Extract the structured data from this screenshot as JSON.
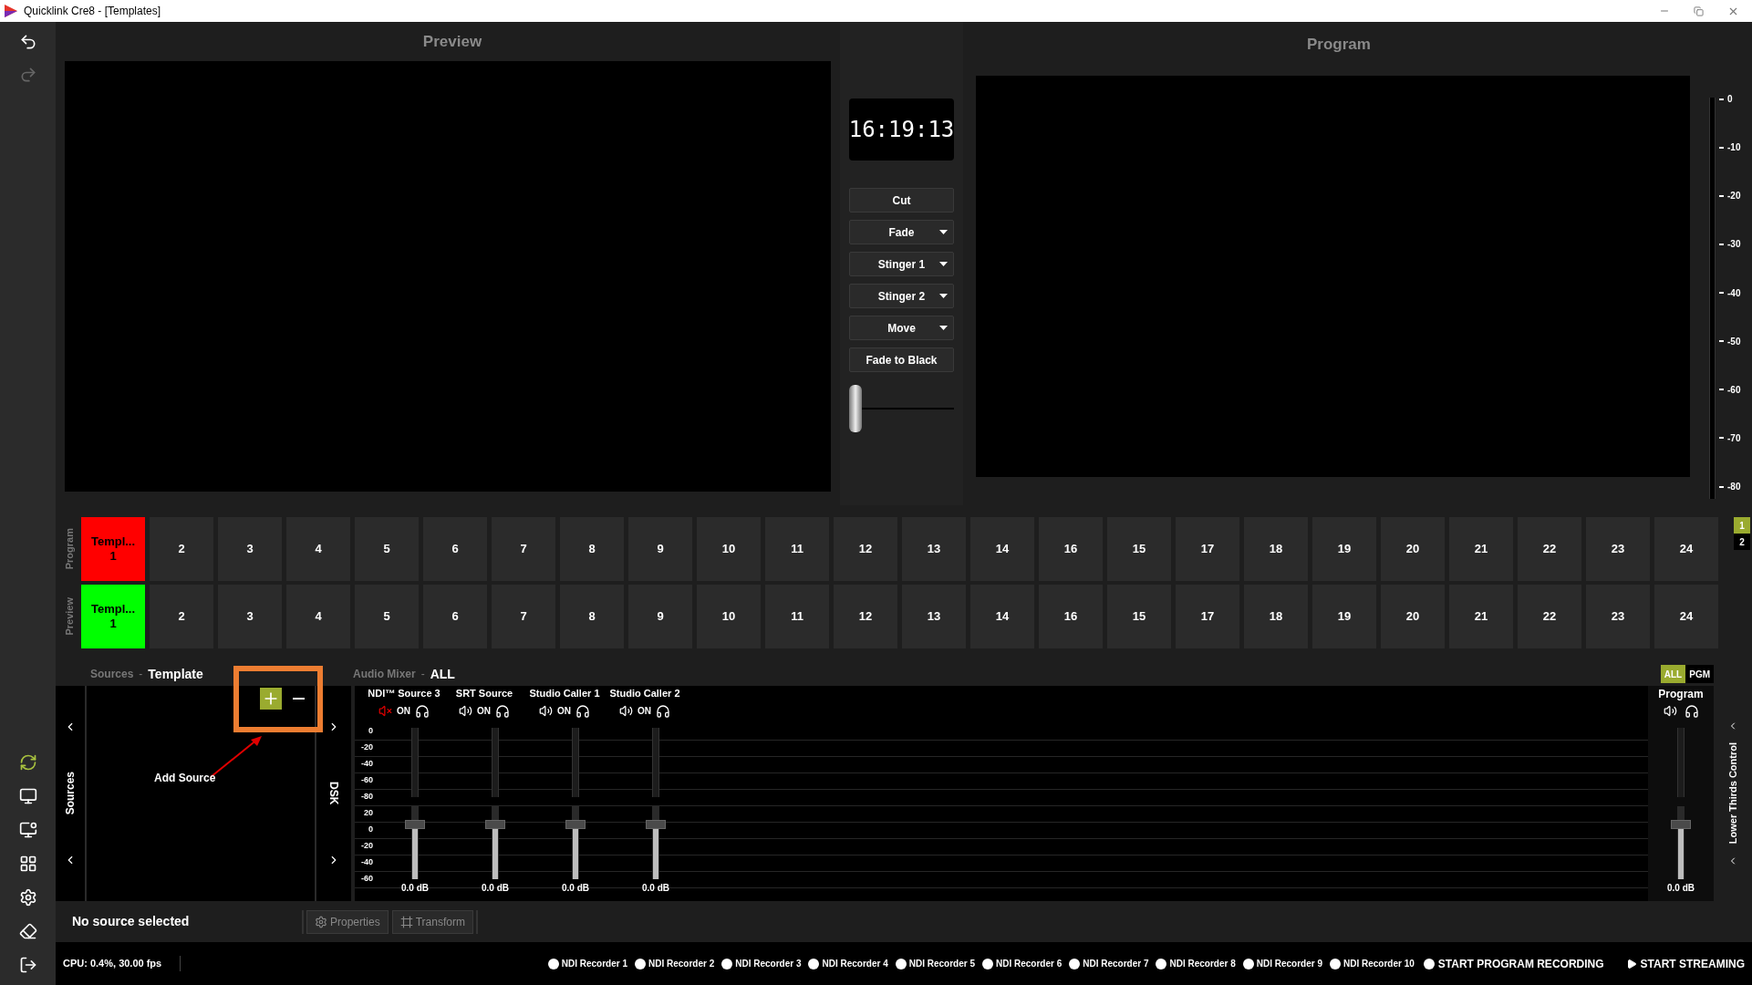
{
  "window": {
    "title": "Quicklink Cre8 - [Templates]"
  },
  "preview": {
    "label": "Preview"
  },
  "program": {
    "label": "Program"
  },
  "clock": "16:19:13",
  "transitions": [
    {
      "label": "Cut",
      "dropdown": false
    },
    {
      "label": "Fade",
      "dropdown": true
    },
    {
      "label": "Stinger 1",
      "dropdown": true
    },
    {
      "label": "Stinger 2",
      "dropdown": true
    },
    {
      "label": "Move",
      "dropdown": true
    },
    {
      "label": "Fade to Black",
      "dropdown": false
    }
  ],
  "t_bar": {
    "level": 0
  },
  "vu_meter": {
    "ticks": [
      "0",
      "-10",
      "-20",
      "-30",
      "-40",
      "-50",
      "-60",
      "-70",
      "-80"
    ]
  },
  "switcher": {
    "rows": [
      {
        "label": "Program",
        "kind": "program",
        "cells": [
          {
            "label": "Templ...",
            "number": "1",
            "selected": true
          },
          {
            "label": "2",
            "selected": false
          },
          {
            "label": "3",
            "selected": false
          },
          {
            "label": "4",
            "selected": false
          },
          {
            "label": "5",
            "selected": false
          },
          {
            "label": "6",
            "selected": false
          },
          {
            "label": "7",
            "selected": false
          },
          {
            "label": "8",
            "selected": false
          },
          {
            "label": "9",
            "selected": false
          },
          {
            "label": "10",
            "selected": false
          },
          {
            "label": "11",
            "selected": false
          },
          {
            "label": "12",
            "selected": false
          },
          {
            "label": "13",
            "selected": false
          },
          {
            "label": "14",
            "selected": false
          },
          {
            "label": "16",
            "selected": false
          },
          {
            "label": "15",
            "selected": false
          },
          {
            "label": "17",
            "selected": false
          },
          {
            "label": "18",
            "selected": false
          },
          {
            "label": "19",
            "selected": false
          },
          {
            "label": "20",
            "selected": false
          },
          {
            "label": "21",
            "selected": false
          },
          {
            "label": "22",
            "selected": false
          },
          {
            "label": "23",
            "selected": false
          },
          {
            "label": "24",
            "selected": false
          }
        ]
      },
      {
        "label": "Preview",
        "kind": "preview",
        "cells": [
          {
            "label": "Templ...",
            "number": "1",
            "selected": true
          },
          {
            "label": "2",
            "selected": false
          },
          {
            "label": "3",
            "selected": false
          },
          {
            "label": "4",
            "selected": false
          },
          {
            "label": "5",
            "selected": false
          },
          {
            "label": "6",
            "selected": false
          },
          {
            "label": "7",
            "selected": false
          },
          {
            "label": "8",
            "selected": false
          },
          {
            "label": "9",
            "selected": false
          },
          {
            "label": "10",
            "selected": false
          },
          {
            "label": "11",
            "selected": false
          },
          {
            "label": "12",
            "selected": false
          },
          {
            "label": "13",
            "selected": false
          },
          {
            "label": "14",
            "selected": false
          },
          {
            "label": "16",
            "selected": false
          },
          {
            "label": "15",
            "selected": false
          },
          {
            "label": "17",
            "selected": false
          },
          {
            "label": "18",
            "selected": false
          },
          {
            "label": "19",
            "selected": false
          },
          {
            "label": "20",
            "selected": false
          },
          {
            "label": "21",
            "selected": false
          },
          {
            "label": "22",
            "selected": false
          },
          {
            "label": "23",
            "selected": false
          },
          {
            "label": "24",
            "selected": false
          }
        ]
      }
    ],
    "pages": [
      {
        "label": "1",
        "selected": true
      },
      {
        "label": "2",
        "selected": false
      }
    ]
  },
  "sources": {
    "title": "Sources",
    "separator": "-",
    "subtitle": "Template",
    "side_label": "Sources",
    "annotation": "Add Source"
  },
  "dsk": {
    "label": "DSK"
  },
  "audio_mixer": {
    "title": "Audio Mixer",
    "separator": "-",
    "filter": "ALL",
    "toggles": [
      {
        "label": "ALL",
        "selected": true
      },
      {
        "label": "PGM",
        "selected": false
      }
    ],
    "scale": [
      "0",
      "-20",
      "-40",
      "-60",
      "-80",
      "20",
      "0",
      "-20",
      "-40",
      "-60"
    ],
    "channels": [
      {
        "name": "NDI™ Source 3",
        "muted": true,
        "state": "ON",
        "level": 0.75,
        "reading": "0.0 dB"
      },
      {
        "name": "SRT Source",
        "muted": false,
        "state": "ON",
        "level": 0.75,
        "reading": "0.0 dB"
      },
      {
        "name": "Studio Caller 1",
        "muted": false,
        "state": "ON",
        "level": 0.75,
        "reading": "0.0 dB"
      },
      {
        "name": "Studio Caller 2",
        "muted": false,
        "state": "ON",
        "level": 0.75,
        "reading": "0.0 dB"
      }
    ],
    "master": {
      "name": "Program",
      "level": 0.75,
      "reading": "0.0 dB"
    }
  },
  "lower_thirds": {
    "label": "Lower Thirds Control"
  },
  "toolbar": {
    "status": "No source selected",
    "buttons": [
      {
        "label": "Properties",
        "kind": "properties",
        "disabled": true
      },
      {
        "label": "Transform",
        "kind": "transform",
        "disabled": true
      }
    ]
  },
  "status_bar": {
    "cpu": "CPU: 0.4%, 30.00 fps",
    "recorders": [
      "NDI Recorder 1",
      "NDI Recorder 2",
      "NDI Recorder 3",
      "NDI Recorder 4",
      "NDI Recorder 5",
      "NDI Recorder 6",
      "NDI Recorder 7",
      "NDI Recorder 8",
      "NDI Recorder 9",
      "NDI Recorder 10"
    ],
    "record": "START PROGRAM RECORDING",
    "stream": "START STREAMING"
  }
}
